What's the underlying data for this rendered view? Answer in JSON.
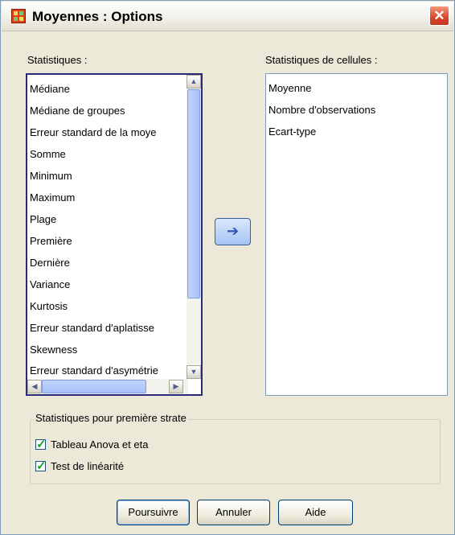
{
  "window": {
    "title": "Moyennes : Options",
    "close_glyph": "✕"
  },
  "statistics": {
    "label": "Statistiques :",
    "items": [
      "Médiane",
      "Médiane de groupes",
      "Erreur standard de la moye",
      "Somme",
      "Minimum",
      "Maximum",
      "Plage",
      "Première",
      "Dernière",
      "Variance",
      "Kurtosis",
      "Erreur standard d'aplatisse",
      "Skewness",
      "Erreur standard d'asymétrie"
    ]
  },
  "cell_statistics": {
    "label": "Statistiques de cellules :",
    "items": [
      "Moyenne",
      "Nombre d'observations",
      "Ecart-type"
    ]
  },
  "move_button": {
    "icon": "arrow-right-icon",
    "glyph": "➔"
  },
  "first_layer": {
    "title": "Statistiques pour première strate",
    "options": [
      {
        "label": "Tableau Anova et eta",
        "checked": true
      },
      {
        "label": "Test de linéarité",
        "checked": true
      }
    ]
  },
  "buttons": {
    "continue": "Poursuivre",
    "cancel": "Annuler",
    "help": "Aide"
  },
  "colors": {
    "dialog_background": "#ece9d8",
    "focus_border": "#2a2a78",
    "close_button": "#d9442a"
  }
}
